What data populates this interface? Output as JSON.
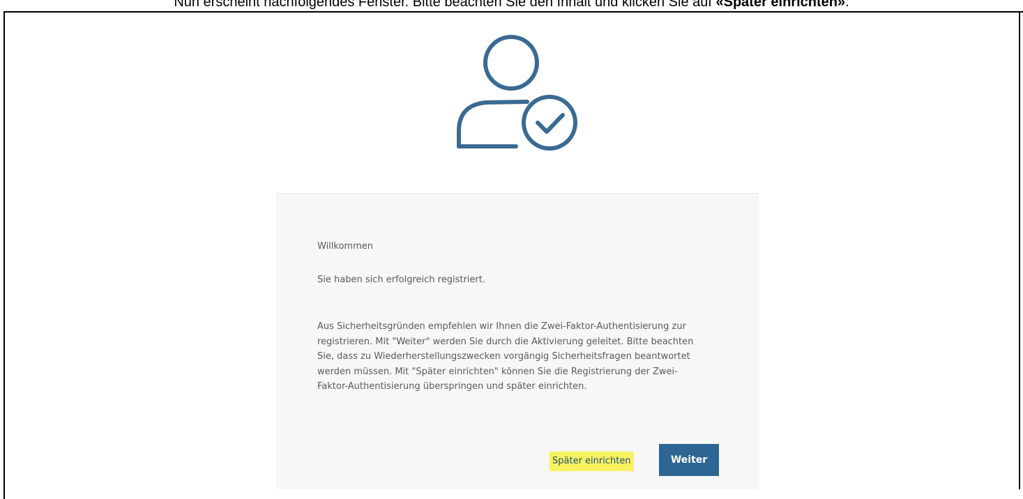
{
  "instruction": {
    "text_before": "Nun erscheint nachfolgendes Fenster. Bitte beachten Sie den Inhalt und klicken Sie auf ",
    "text_bold": "«Später einrichten»",
    "text_after": "."
  },
  "dialog": {
    "icon": "user-check-icon",
    "title": "Willkommen",
    "success_message": "Sie haben sich erfolgreich registriert.",
    "body": "Aus Sicherheitsgründen empfehlen wir Ihnen die Zwei-Faktor-Authentisierung zur registrieren. Mit \"Weiter\" werden Sie durch die Aktivierung geleitet. Bitte beachten Sie, dass zu Wiederherstellungszwecken vorgängig Sicherheitsfragen beantwortet werden müssen. Mit \"Später einrichten\" können Sie die Registrierung der Zwei-Faktor-Authentisierung überspringen und später einrichten.",
    "later_label": "Später einrichten",
    "next_label": "Weiter"
  },
  "colors": {
    "icon": "#3a6a93",
    "next_button": "#2d6692",
    "highlight": "#f7f260",
    "panel_background": "#f7f7f7"
  }
}
